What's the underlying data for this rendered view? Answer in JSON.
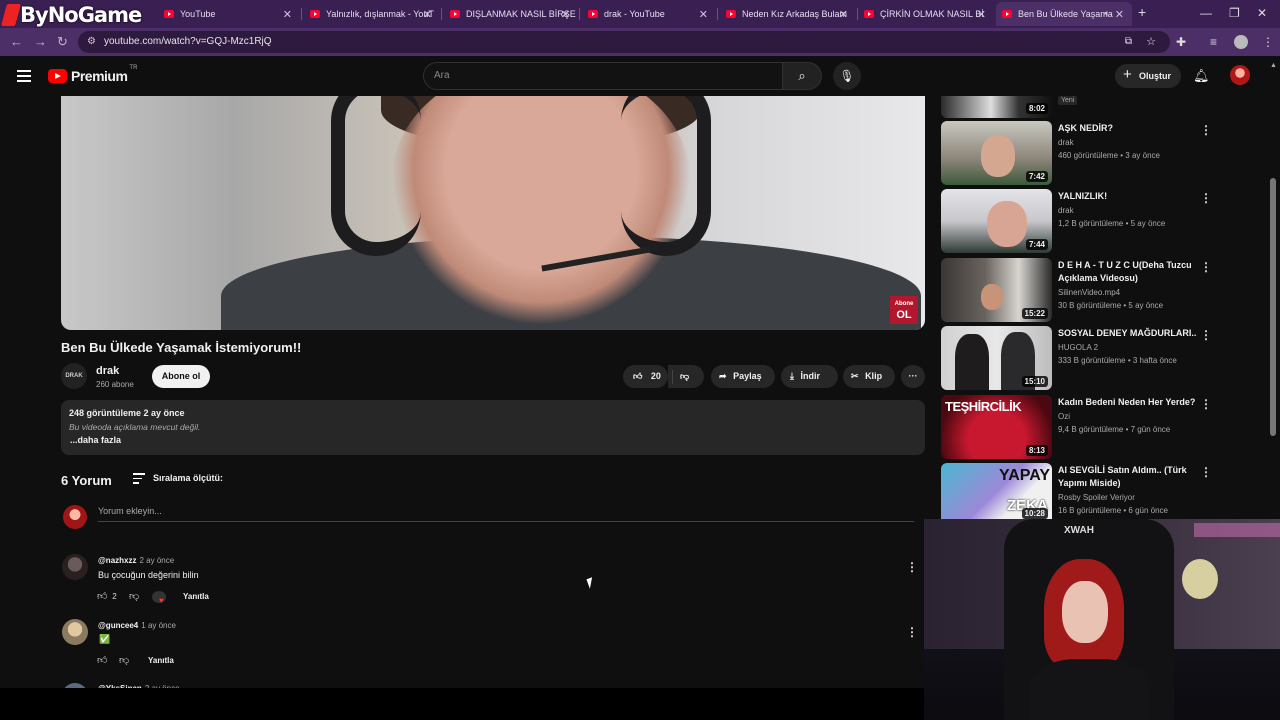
{
  "overlay_logo": "ByNoGame",
  "browser": {
    "tabs": [
      {
        "label": "YouTube"
      },
      {
        "label": "Yalnızlık, dışlanmak - YouT"
      },
      {
        "label": "DIŞLANMAK NASIL BİRŞE"
      },
      {
        "label": "drak - YouTube"
      },
      {
        "label": "Neden Kız Arkadaş Bulam"
      },
      {
        "label": "ÇİRKİN OLMAK NASIL Bİ"
      },
      {
        "label": "Ben Bu Ülkede Yaşama"
      }
    ],
    "new_tab": "+",
    "url": "youtube.com/watch?v=GQJ-Mzc1RjQ"
  },
  "header": {
    "logo_word": "Premium",
    "region": "TR",
    "search_placeholder": "Ara",
    "create_label": "Oluştur"
  },
  "video": {
    "overlay_badge_top": "Abone",
    "overlay_badge_bottom": "OL",
    "title": "Ben Bu Ülkede Yaşamak İstemiyorum!!",
    "channel_avatar_text": "DRAK",
    "channel": "drak",
    "subscribers": "260 abone",
    "subscribe_label": "Abone ol",
    "likes": "20",
    "share_label": "Paylaş",
    "download_label": "İndir",
    "clip_label": "Klip"
  },
  "description": {
    "stats": "248 görüntüleme  2 ay önce",
    "text": "Bu videoda açıklama mevcut değil.",
    "more": "...daha fazla"
  },
  "comments": {
    "count": "6 Yorum",
    "sort_label": "Sıralama ölçütü:",
    "add_placeholder": "Yorum ekleyin...",
    "items": [
      {
        "user": "@nazhxzz",
        "time": "2 ay önce",
        "text": "Bu çocuğun değerini bilin",
        "likes": "2",
        "reply": "Yanıtla"
      },
      {
        "user": "@guncee4",
        "time": "1 ay önce",
        "text": "✅",
        "likes": "",
        "reply": "Yanıtla"
      },
      {
        "user": "@YksSinan",
        "time": "2 ay önce"
      }
    ]
  },
  "related": [
    {
      "duration": "8:02",
      "badge": "Yeni"
    },
    {
      "title": "AŞK NEDİR?",
      "channel": "drak",
      "meta": "460 görüntüleme • 3 ay önce",
      "duration": "7:42"
    },
    {
      "title": "YALNIZLIK!",
      "channel": "drak",
      "meta": "1,2 B görüntüleme • 5 ay önce",
      "duration": "7:44"
    },
    {
      "title": "D E H A - T U Z C U(Deha Tuzcu Açıklama Videosu)",
      "channel": "SilinenVideo.mp4",
      "meta": "30 B görüntüleme • 5 ay önce",
      "duration": "15:22"
    },
    {
      "title": "SOSYAL DENEY MAĞDURLARI..",
      "channel": "HUGOLA 2",
      "meta": "333 B görüntüleme • 3 hafta önce",
      "duration": "15:10"
    },
    {
      "title": "Kadın Bedeni Neden Her Yerde?",
      "channel": "Ozi",
      "meta": "9,4 B görüntüleme • 7 gün önce",
      "duration": "8:13",
      "thumb_text": "TEŞHİRCİLİK"
    },
    {
      "title": "AI SEVGİLİ Satın Aldım.. (Türk Yapımı Miside)",
      "channel": "Rosby Spoiler Veriyor",
      "meta": "16 B görüntüleme • 6 gün önce",
      "duration": "10:28",
      "thumb_text_1": "YAPAY",
      "thumb_text_2": "ZEKA"
    }
  ],
  "webcam": {
    "chair_text": "XWAH"
  }
}
